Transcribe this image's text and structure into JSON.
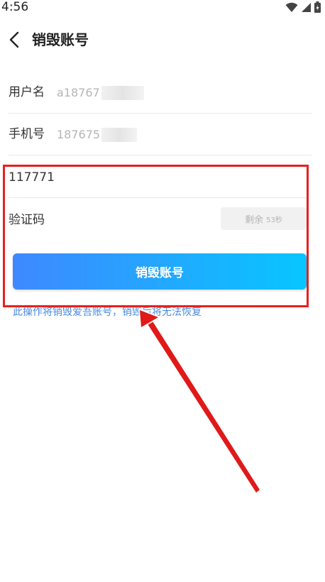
{
  "status_bar": {
    "time": "4:56"
  },
  "header": {
    "title": "销毁账号"
  },
  "account": {
    "username_label": "用户名",
    "username_value": "a18767",
    "phone_label": "手机号",
    "phone_value": "187675"
  },
  "verification": {
    "code_value": "117771",
    "label": "验证码",
    "countdown_text": "剩余",
    "countdown_seconds": "53秒"
  },
  "actions": {
    "destroy_label": "销毁账号"
  },
  "warning": {
    "text": "此操作将销毁爱吾账号，销毁后将无法恢复"
  },
  "colors": {
    "accent_start": "#3f88ff",
    "accent_end": "#07c6ff",
    "annotation_red": "#e8201f",
    "warning_blue": "#4a8ae0"
  },
  "icons": [
    "wifi-icon",
    "signal-icon",
    "battery-icon",
    "back-arrow-icon"
  ]
}
